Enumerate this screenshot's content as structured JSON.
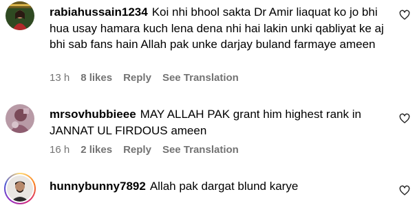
{
  "comments": [
    {
      "username": "rabiahussain1234",
      "text": "Koi nhi bhool sakta Dr Amir liaquat ko jo bhi hua usay hamara kuch lena dena nhi hai lakin unki qabliyat ke aj bhi sab fans hain Allah pak unke darjay buland farmaye ameen",
      "time": "13 h",
      "likes": "8 likes",
      "reply": "Reply",
      "translate": "See Translation",
      "avatar_icon": "profile-photo",
      "like_icon": "heart-outline-icon"
    },
    {
      "username": "mrsovhubbieee",
      "text": "MAY ALLAH PAK grant him highest rank in JANNAT UL FIRDOUS ameen",
      "time": "16 h",
      "likes": "2 likes",
      "reply": "Reply",
      "translate": "See Translation",
      "avatar_icon": "profile-photo",
      "like_icon": "heart-outline-icon"
    },
    {
      "username": "hunnybunny7892",
      "text": "Allah pak dargat blund karye",
      "avatar_icon": "profile-photo-with-story-ring",
      "like_icon": "heart-outline-icon"
    }
  ],
  "colors": {
    "meta_text": "#737373",
    "text": "#000000",
    "story_ring": "#d62976"
  }
}
